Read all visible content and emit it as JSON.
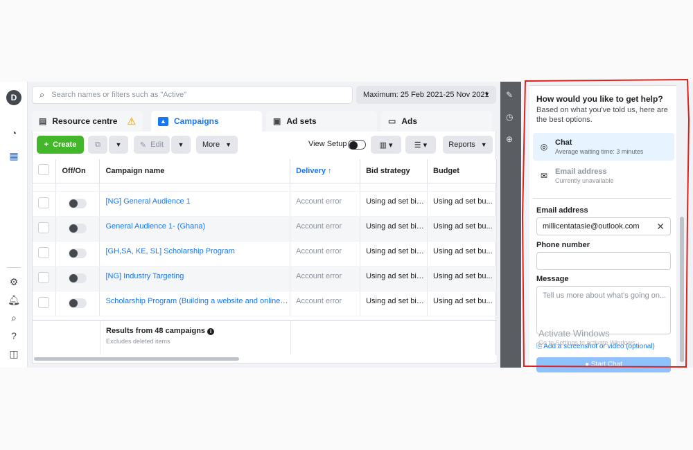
{
  "rail": {
    "avatar": "D",
    "icons": [
      "gauge-icon",
      "table-grid-icon",
      "settings-icon",
      "bell-icon",
      "search-icon",
      "help-icon",
      "panel-icon"
    ]
  },
  "search": {
    "placeholder": "Search names or filters such as \"Active\""
  },
  "date_range": "Maximum: 25 Feb 2021-25 Nov 2021",
  "tabs": [
    {
      "label": "Resource centre"
    },
    {
      "label": "Campaigns"
    },
    {
      "label": "Ad sets"
    },
    {
      "label": "Ads"
    }
  ],
  "toolbar": {
    "create": "Create",
    "edit": "Edit",
    "more": "More",
    "view_setup": "View Setup",
    "reports": "Reports"
  },
  "table": {
    "headers": {
      "offon": "Off/On",
      "name": "Campaign name",
      "delivery": "Delivery ↑",
      "bid": "Bid strategy",
      "budget": "Budget"
    },
    "rows": [
      {
        "name": "[NG] General Audience 1",
        "delivery": "Account error",
        "bid": "Using ad set bid...",
        "budget": "Using ad set bu..."
      },
      {
        "name": "General Audience 1- (Ghana)",
        "delivery": "Account error",
        "bid": "Using ad set bid...",
        "budget": "Using ad set bu..."
      },
      {
        "name": "[GH,SA, KE, SL] Scholarship Program",
        "delivery": "Account error",
        "bid": "Using ad set bid...",
        "budget": "Using ad set bu..."
      },
      {
        "name": "[NG] Industry Targeting",
        "delivery": "Account error",
        "bid": "Using ad set bid...",
        "budget": "Using ad set bu..."
      },
      {
        "name": "Scholarship Program (Building a website and online sto...",
        "delivery": "Account error",
        "bid": "Using ad set bid...",
        "budget": "Using ad set bu..."
      }
    ],
    "results_title": "Results from 48 campaigns",
    "results_sub": "Excludes deleted items"
  },
  "help": {
    "title": "How would you like to get help?",
    "subtitle": "Based on what you've told us, here are the best options.",
    "chat_title": "Chat",
    "chat_sub": "Average waiting time: 3 minutes",
    "email_title": "Email address",
    "email_sub": "Currently unavailable",
    "email_label": "Email address",
    "email_value": "millicentatasie@outlook.com",
    "phone_label": "Phone number",
    "message_label": "Message",
    "message_placeholder": "Tell us more about what's going on...",
    "add_screenshot": "Add a screenshot or video (optional)",
    "start_chat": "Start Chat"
  },
  "watermark": {
    "line1": "Activate Windows",
    "line2": "Go to Settings to activate Windows."
  },
  "colors": {
    "accent": "#1877f2",
    "create_green": "#42b72a",
    "annotation_red": "#e0201b"
  }
}
